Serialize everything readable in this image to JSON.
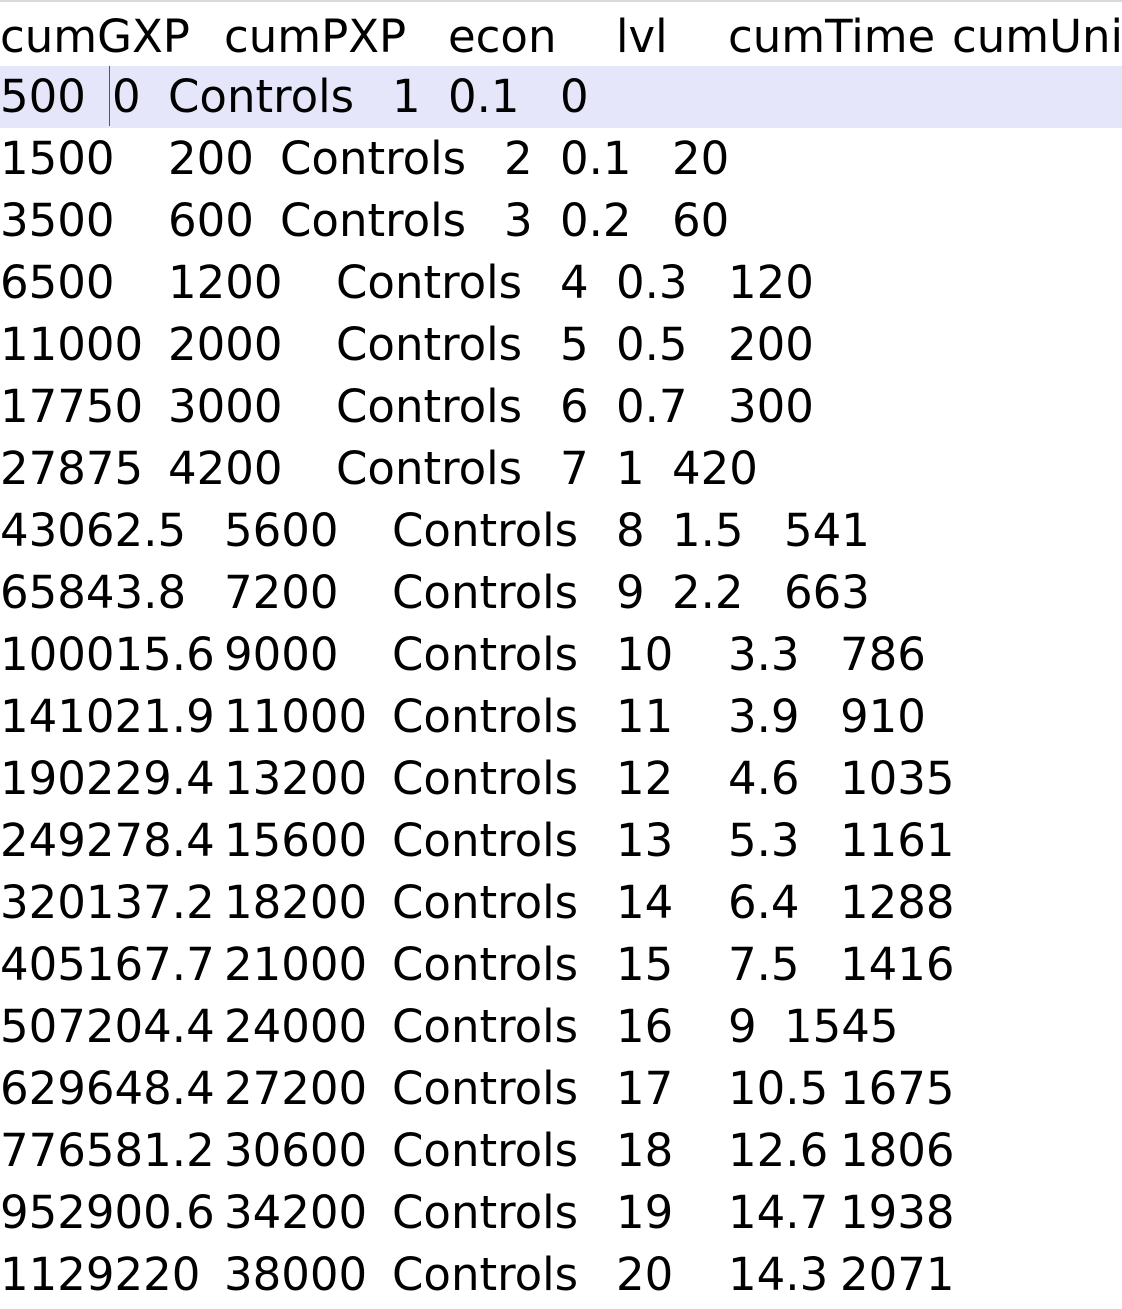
{
  "editor": {
    "lines": [
      "cumGXP\tcumPXP\tecon\tlvl\tcumTime\tcumUnits",
      "500\t0\tControls\t1\t0.1\t0",
      "1500\t200\tControls\t2\t0.1\t20",
      "3500\t600\tControls\t3\t0.2\t60",
      "6500\t1200\tControls\t4\t0.3\t120",
      "11000\t2000\tControls\t5\t0.5\t200",
      "17750\t3000\tControls\t6\t0.7\t300",
      "27875\t4200\tControls\t7\t1\t420",
      "43062.5\t5600\tControls\t8\t1.5\t541",
      "65843.8\t7200\tControls\t9\t2.2\t663",
      "100015.6\t9000\tControls\t10\t3.3\t786",
      "141021.9\t11000\tControls\t11\t3.9\t910",
      "190229.4\t13200\tControls\t12\t4.6\t1035",
      "249278.4\t15600\tControls\t13\t5.3\t1161",
      "320137.2\t18200\tControls\t14\t6.4\t1288",
      "405167.7\t21000\tControls\t15\t7.5\t1416",
      "507204.4\t24000\tControls\t16\t9\t1545",
      "629648.4\t27200\tControls\t17\t10.5\t1675",
      "776581.2\t30600\tControls\t18\t12.6\t1806",
      "952900.6\t34200\tControls\t19\t14.7\t1938",
      "1129220\t38000\tControls\t20\t14.3\t2071"
    ],
    "current_line": 2,
    "colors": {
      "background": "#ffffff",
      "current_line_highlight": "#e6e6fa",
      "text": "#000000",
      "caret": "#a0306a"
    }
  }
}
